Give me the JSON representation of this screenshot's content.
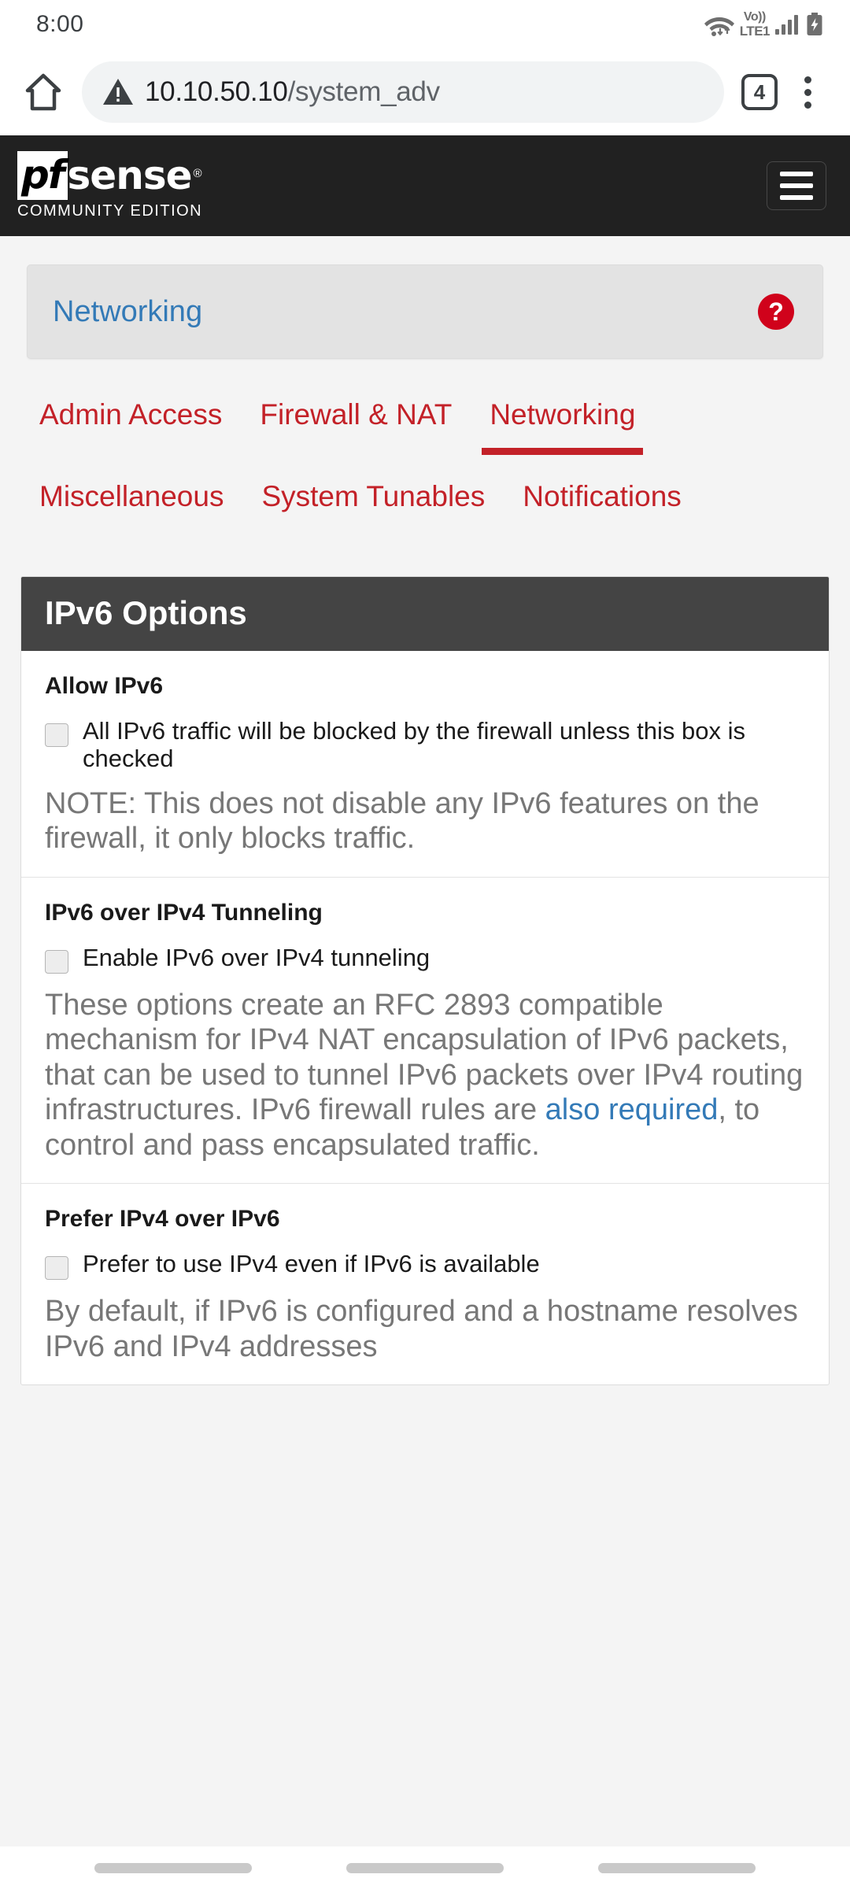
{
  "status_bar": {
    "clock": "8:00",
    "volte_top": "Vo))",
    "volte_bottom": "LTE1",
    "wifi_icon": "wifi-icon",
    "signal_icon": "signal-bars-icon",
    "battery_icon": "battery-charging-icon"
  },
  "browser": {
    "home_icon": "home-icon",
    "security_icon": "warning-triangle-icon",
    "url_host": "10.10.50.10",
    "url_path": "/system_adv",
    "url_full": "10.10.50.10/system_adv",
    "tab_count": "4",
    "menu_icon": "overflow-menu-icon"
  },
  "pfsense_header": {
    "logo_pf": "pf",
    "logo_sense": "sense",
    "logo_reg": "®",
    "edition": "COMMUNITY EDITION",
    "menu_toggle_icon": "hamburger-icon"
  },
  "breadcrumb": {
    "label": "Networking",
    "help_glyph": "?"
  },
  "tabs": {
    "row1": [
      {
        "label": "Admin Access",
        "active": false
      },
      {
        "label": "Firewall & NAT",
        "active": false
      },
      {
        "label": "Networking",
        "active": true
      }
    ],
    "row2": [
      {
        "label": "Miscellaneous",
        "active": false
      },
      {
        "label": "System Tunables",
        "active": false
      },
      {
        "label": "Notifications",
        "active": false
      }
    ]
  },
  "panel": {
    "title": "IPv6 Options",
    "sections": [
      {
        "label": "Allow IPv6",
        "checkbox_label": "All IPv6 traffic will be blocked by the firewall unless this box is checked",
        "checked": false,
        "help": "NOTE: This does not disable any IPv6 features on the firewall, it only blocks traffic."
      },
      {
        "label": "IPv6 over IPv4 Tunneling",
        "checkbox_label": "Enable IPv6 over IPv4 tunneling",
        "checked": false,
        "help_part1": "These options create an RFC 2893 compatible mechanism for IPv4 NAT encapsulation of IPv6 packets, that can be used to tunnel IPv6 packets over IPv4 routing infrastructures. IPv6 firewall rules are ",
        "help_link": "also required",
        "help_part2": ", to control and pass encapsulated traffic."
      },
      {
        "label": "Prefer IPv4 over IPv6",
        "checkbox_label": "Prefer to use IPv4 even if IPv6 is available",
        "checked": false,
        "help": "By default, if IPv6 is configured and a hostname resolves IPv6 and IPv4 addresses"
      }
    ]
  },
  "colors": {
    "brand_red": "#c32128",
    "link_blue": "#337ab7",
    "header_dark": "#212121",
    "panel_head": "#444444",
    "help_red": "#d0021b"
  },
  "nav_bar": {
    "back_icon": "nav-pill-left",
    "home_icon": "nav-pill-center",
    "recents_icon": "nav-pill-right"
  }
}
